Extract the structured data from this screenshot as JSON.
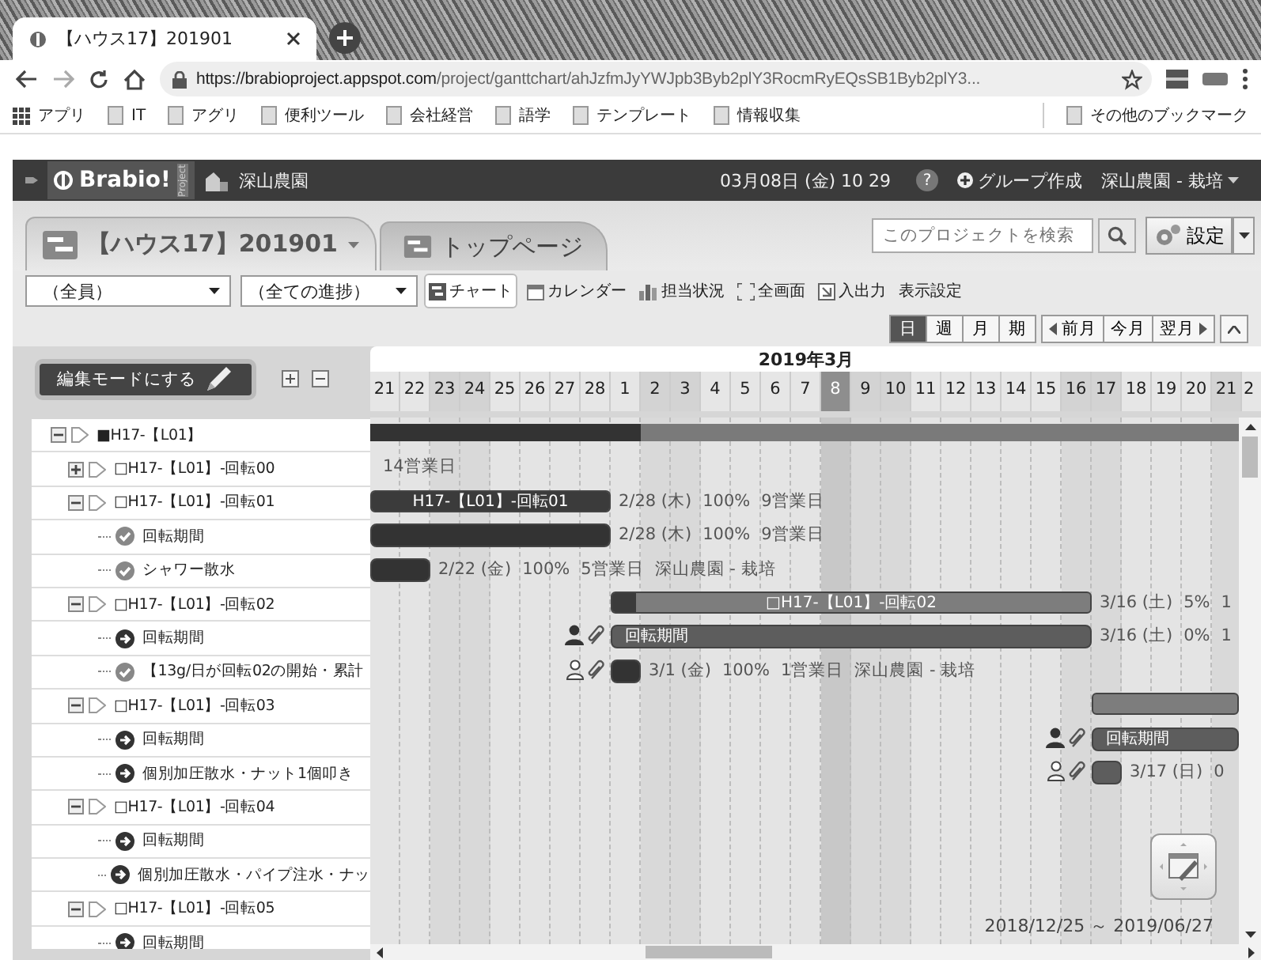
{
  "browser": {
    "tab_title": "【ハウス17】201901",
    "url_host": "https://brabioproject.appspot.com",
    "url_path": "/project/ganttchart/ahJzfmJyYWJpb3Byb2plY3RocmRyEQsSB1Byb2plY3...",
    "bookmarks": [
      {
        "label": "アプリ",
        "kind": "apps"
      },
      {
        "label": "IT",
        "kind": "page"
      },
      {
        "label": "アグリ",
        "kind": "page"
      },
      {
        "label": "便利ツール",
        "kind": "page"
      },
      {
        "label": "会社経営",
        "kind": "page"
      },
      {
        "label": "語学",
        "kind": "page"
      },
      {
        "label": "テンプレート",
        "kind": "page"
      },
      {
        "label": "情報収集",
        "kind": "page"
      }
    ],
    "other_bookmarks": "その他のブックマーク"
  },
  "app_bar": {
    "logo": "Brabio!",
    "logo_tag": "Project",
    "org": "深山農園",
    "datetime": "03月08日 (金) 10 29",
    "help": "?",
    "create_group": "グループ作成",
    "user": "深山農園 - 栽培"
  },
  "project_tabs": [
    {
      "label": "【ハウス17】201901",
      "selected": true
    },
    {
      "label": "トップページ",
      "selected": false
    }
  ],
  "search": {
    "placeholder": "このプロジェクトを検索"
  },
  "settings": "設定",
  "filters": [
    "（全員）",
    "（全ての進捗）"
  ],
  "views": [
    {
      "label": "チャート",
      "kind": "chart",
      "selected": true
    },
    {
      "label": "カレンダー",
      "kind": "calendar",
      "selected": false
    },
    {
      "label": "担当状況",
      "kind": "workload",
      "selected": false
    },
    {
      "label": "全画面",
      "kind": "fullscreen",
      "selected": false
    },
    {
      "label": "入出力",
      "kind": "io",
      "selected": false
    },
    {
      "label": "表示設定",
      "kind": "text",
      "selected": false
    }
  ],
  "scale": [
    {
      "label": "日",
      "selected": true
    },
    {
      "label": "週",
      "selected": false
    },
    {
      "label": "月",
      "selected": false
    },
    {
      "label": "期",
      "selected": false
    }
  ],
  "nav": [
    {
      "label": "前月",
      "kind": "prev"
    },
    {
      "label": "今月",
      "kind": "plain"
    },
    {
      "label": "翌月",
      "kind": "next"
    }
  ],
  "edit_mode": "編集モードにする",
  "gantt": {
    "month": "2019年3月",
    "range": "2018/12/25 ～ 2019/06/27",
    "days": [
      {
        "label": "21",
        "kind": "weekday"
      },
      {
        "label": "22",
        "kind": "weekday"
      },
      {
        "label": "23",
        "kind": "weekend"
      },
      {
        "label": "24",
        "kind": "weekend"
      },
      {
        "label": "25",
        "kind": "weekday"
      },
      {
        "label": "26",
        "kind": "weekday"
      },
      {
        "label": "27",
        "kind": "weekday"
      },
      {
        "label": "28",
        "kind": "weekday"
      },
      {
        "label": "1",
        "kind": "weekday"
      },
      {
        "label": "2",
        "kind": "weekend"
      },
      {
        "label": "3",
        "kind": "weekend"
      },
      {
        "label": "4",
        "kind": "weekday"
      },
      {
        "label": "5",
        "kind": "weekday"
      },
      {
        "label": "6",
        "kind": "weekday"
      },
      {
        "label": "7",
        "kind": "weekday"
      },
      {
        "label": "8",
        "kind": "today"
      },
      {
        "label": "9",
        "kind": "weekend"
      },
      {
        "label": "10",
        "kind": "weekend"
      },
      {
        "label": "11",
        "kind": "weekday"
      },
      {
        "label": "12",
        "kind": "weekday"
      },
      {
        "label": "13",
        "kind": "weekday"
      },
      {
        "label": "14",
        "kind": "weekday"
      },
      {
        "label": "15",
        "kind": "weekday"
      },
      {
        "label": "16",
        "kind": "weekend"
      },
      {
        "label": "17",
        "kind": "weekend"
      },
      {
        "label": "18",
        "kind": "weekday"
      },
      {
        "label": "19",
        "kind": "weekday"
      },
      {
        "label": "20",
        "kind": "weekday"
      },
      {
        "label": "21",
        "kind": "weekend"
      },
      {
        "label": "2",
        "kind": "weekday"
      }
    ]
  },
  "tree": [
    {
      "label": "■H17-【L01】",
      "kind": "group",
      "expanded": true,
      "bar": {
        "kind": "project",
        "level": 0.3
      },
      "children": [
        {
          "label": "□H17-【L01】-回転00",
          "kind": "group",
          "expanded": false,
          "notes": [
            "14営業日"
          ]
        },
        {
          "label": "□H17-【L01】-回転01",
          "kind": "group",
          "expanded": true,
          "bar": {
            "kind": "summary",
            "level": 1,
            "label": "H17-【L01】-回転01"
          },
          "notes": [
            "2/28 (木)",
            "100%",
            "9営業日"
          ],
          "children": [
            {
              "label": "回転期間",
              "kind": "task",
              "done": true,
              "bar": {
                "kind": "task",
                "level": 1
              },
              "notes": [
                "2/28 (木)",
                "100%",
                "9営業日"
              ]
            },
            {
              "label": "シャワー散水",
              "kind": "task",
              "done": true,
              "bar": {
                "kind": "task",
                "level": 1
              },
              "notes": [
                "2/22 (金)",
                "100%",
                "5営業日",
                "深山農園 - 栽培"
              ]
            }
          ]
        },
        {
          "label": "□H17-【L01】-回転02",
          "kind": "group",
          "expanded": true,
          "bar": {
            "kind": "summary",
            "level": 0.05,
            "label": "□H17-【L01】-回転02"
          },
          "notes": [
            "3/16 (土)",
            "5%",
            "1"
          ],
          "children": [
            {
              "label": "回転期間",
              "kind": "task",
              "done": false,
              "marker_filled": true,
              "bar": {
                "kind": "task",
                "level": 0,
                "label": "回転期間"
              },
              "notes": [
                "3/16 (土)",
                "0%",
                "1"
              ]
            },
            {
              "label": "【13g/日が回転02の開始・累計",
              "kind": "task",
              "done": true,
              "marker_filled": false,
              "bar": {
                "kind": "task",
                "level": 1
              },
              "notes": [
                "3/1 (金)",
                "100%",
                "1営業日",
                "深山農園 - 栽培"
              ]
            }
          ]
        },
        {
          "label": "□H17-【L01】-回転03",
          "kind": "group",
          "expanded": true,
          "bar": {
            "kind": "summary",
            "level": 0
          },
          "children": [
            {
              "label": "回転期間",
              "kind": "task",
              "done": false,
              "marker_filled": true,
              "bar": {
                "kind": "task",
                "level": 0,
                "label": "回転期間"
              }
            },
            {
              "label": "個別加圧散水・ナット1個叩き",
              "kind": "task",
              "done": false,
              "marker_filled": false,
              "bar": {
                "kind": "task",
                "level": 0
              },
              "notes": [
                "3/17 (日)",
                "0"
              ]
            }
          ]
        },
        {
          "label": "□H17-【L01】-回転04",
          "kind": "group",
          "expanded": true,
          "children": [
            {
              "label": "回転期間",
              "kind": "task",
              "done": false
            },
            {
              "label": "個別加圧散水・パイプ注水・ナッ",
              "kind": "task",
              "done": false
            }
          ]
        },
        {
          "label": "□H17-【L01】-回転05",
          "kind": "group",
          "expanded": true,
          "children": [
            {
              "label": "回転期間",
              "kind": "task",
              "done": false
            }
          ]
        }
      ]
    }
  ]
}
